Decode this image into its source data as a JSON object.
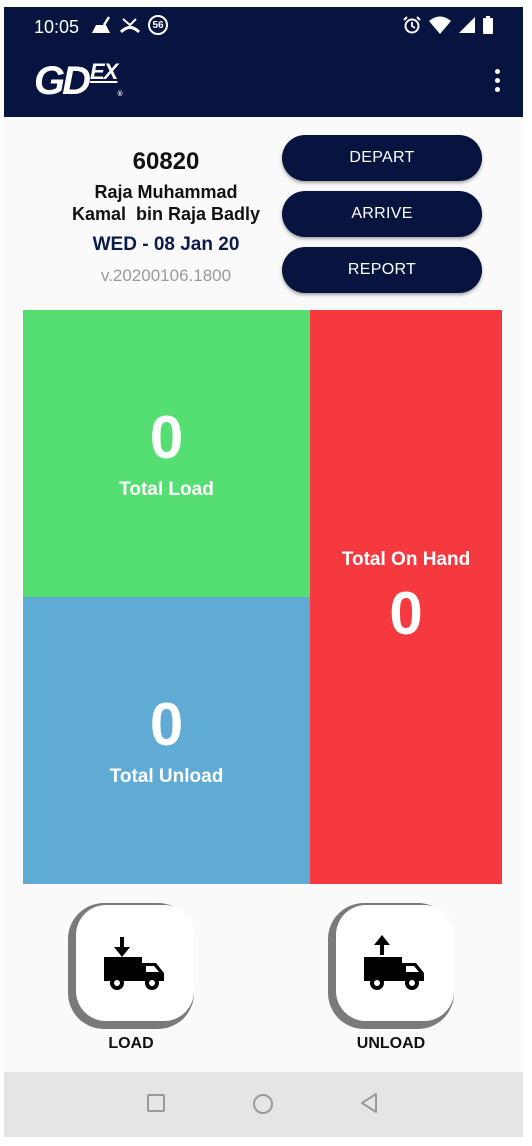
{
  "status_bar": {
    "time": "10:05",
    "badge": "56",
    "left_icons": [
      "cleaning-icon",
      "missed-call-icon",
      "badge-icon"
    ],
    "right_icons": [
      "alarm-icon",
      "wifi-icon",
      "signal-icon",
      "battery-icon"
    ]
  },
  "app_bar": {
    "logo_gd": "GD",
    "logo_ex": "EX",
    "logo_reg": "®",
    "menu_icon": "more-vert-icon",
    "color": "#06143f"
  },
  "profile": {
    "id": "60820",
    "name": "Raja Muhammad\nKamal  bin Raja Badly",
    "date": "WED - 08 Jan 20",
    "version": "v.20200106.1800"
  },
  "actions": {
    "depart": "DEPART",
    "arrive": "ARRIVE",
    "report": "REPORT"
  },
  "stats": {
    "total_load": {
      "value": "0",
      "label": "Total Load",
      "color": "#55df73"
    },
    "total_unload": {
      "value": "0",
      "label": "Total Unload",
      "color": "#5fabd3"
    },
    "total_on_hand": {
      "value": "0",
      "label": "Total On Hand",
      "color": "#f5393f"
    }
  },
  "fabs": {
    "load": {
      "label": "LOAD",
      "icon": "truck-load-icon"
    },
    "unload": {
      "label": "UNLOAD",
      "icon": "truck-unload-icon"
    }
  },
  "nav_bar": {
    "icons": [
      "recents-square-icon",
      "home-circle-icon",
      "back-triangle-icon"
    ]
  }
}
